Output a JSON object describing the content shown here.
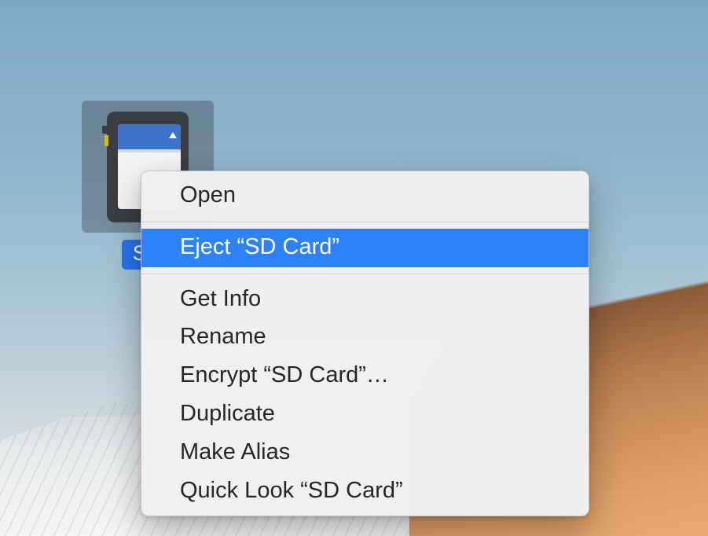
{
  "desktop": {
    "icon_label": "SD",
    "icon_alt": "SD Card volume"
  },
  "context_menu": {
    "items": [
      {
        "label": "Open",
        "highlighted": false
      },
      {
        "separator": true
      },
      {
        "label": "Eject “SD Card”",
        "highlighted": true
      },
      {
        "separator": true
      },
      {
        "label": "Get Info",
        "highlighted": false
      },
      {
        "label": "Rename",
        "highlighted": false
      },
      {
        "label": "Encrypt “SD Card”…",
        "highlighted": false
      },
      {
        "label": "Duplicate",
        "highlighted": false
      },
      {
        "label": "Make Alias",
        "highlighted": false
      },
      {
        "label": "Quick Look “SD Card”",
        "highlighted": false
      }
    ]
  }
}
